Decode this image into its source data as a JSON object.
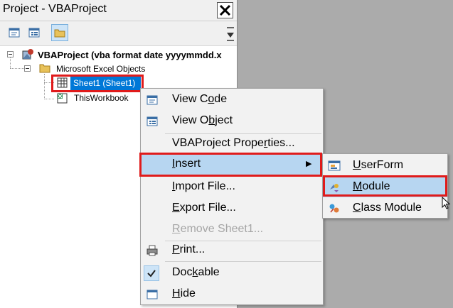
{
  "project_pane": {
    "title": "Project - VBAProject",
    "close_label": "✕",
    "tree": {
      "root": "VBAProject (vba format date yyyymmdd.x",
      "folder": "Microsoft Excel Objects",
      "sheet": "Sheet1 (Sheet1)",
      "workbook": "ThisWorkbook"
    }
  },
  "context_menu": {
    "items": [
      {
        "pre": "View C",
        "u": "o",
        "post": "de"
      },
      {
        "pre": "View O",
        "u": "b",
        "post": "ject"
      },
      {
        "pre": "VBAProject Prope",
        "u": "r",
        "post": "ties..."
      },
      {
        "pre": "",
        "u": "I",
        "post": "nsert"
      },
      {
        "pre": "",
        "u": "I",
        "post": "mport File..."
      },
      {
        "pre": "",
        "u": "E",
        "post": "xport File..."
      },
      {
        "pre": "",
        "u": "R",
        "post": "emove Sheet1..."
      },
      {
        "pre": "",
        "u": "P",
        "post": "rint..."
      },
      {
        "pre": "Doc",
        "u": "k",
        "post": "able"
      },
      {
        "pre": "",
        "u": "H",
        "post": "ide"
      }
    ],
    "submenu_arrow": "▶"
  },
  "submenu": {
    "items": [
      {
        "pre": "",
        "u": "U",
        "post": "serForm"
      },
      {
        "pre": "",
        "u": "M",
        "post": "odule"
      },
      {
        "pre": "",
        "u": "C",
        "post": "lass Module"
      }
    ]
  },
  "colors": {
    "selection": "#0078d7",
    "highlight": "#b7d6f1",
    "annotation_red": "#e01b1b"
  }
}
